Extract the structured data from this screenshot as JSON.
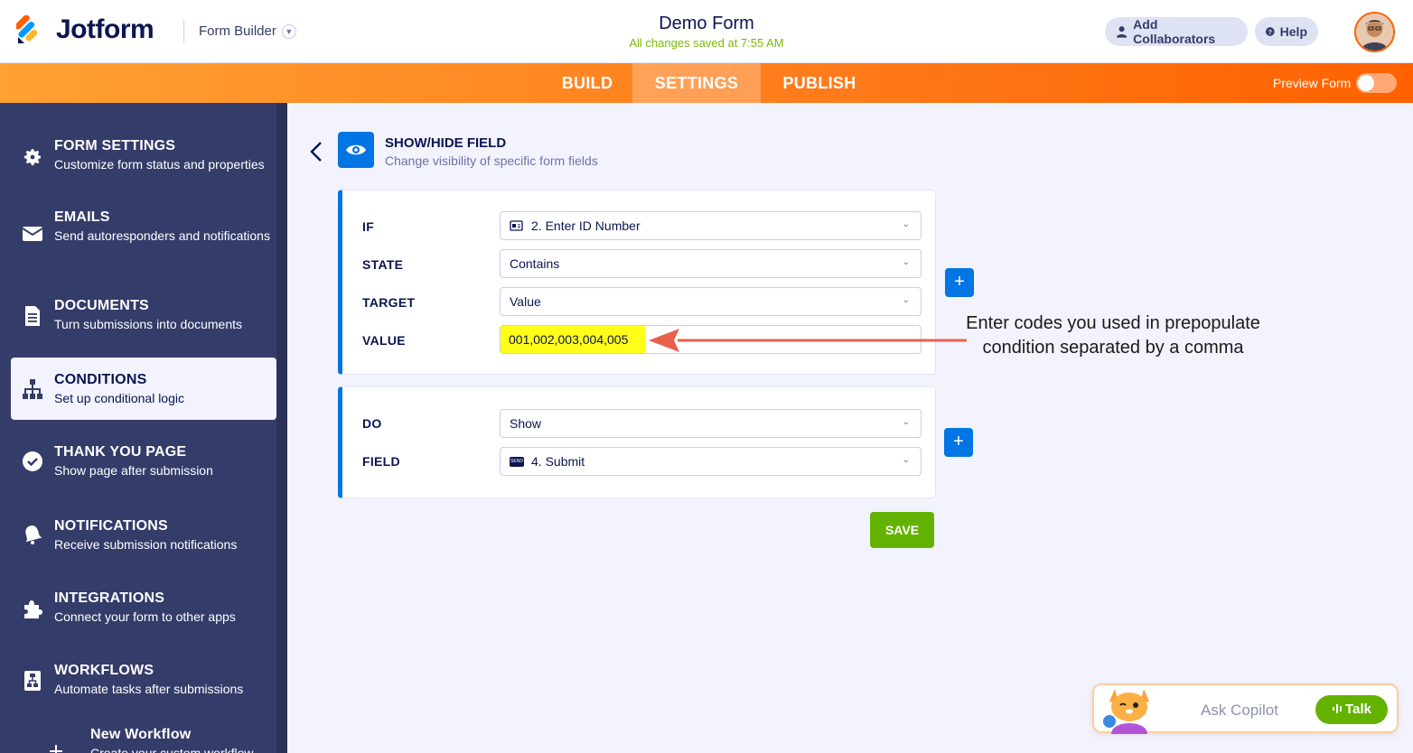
{
  "header": {
    "brand": "Jotform",
    "builder_label": "Form Builder",
    "form_title": "Demo Form",
    "saved_status": "All changes saved at 7:55 AM",
    "add_collaborators": "Add Collaborators",
    "help": "Help"
  },
  "nav": {
    "tabs": [
      "BUILD",
      "SETTINGS",
      "PUBLISH"
    ],
    "active_tab": "SETTINGS",
    "preview_label": "Preview Form",
    "preview_on": false
  },
  "sidebar": {
    "items": [
      {
        "title": "FORM SETTINGS",
        "subtitle": "Customize form status and properties",
        "icon": "gear-icon"
      },
      {
        "title": "EMAILS",
        "subtitle": "Send autoresponders and notifications",
        "icon": "envelope-icon"
      },
      {
        "title": "DOCUMENTS",
        "subtitle": "Turn submissions into documents",
        "icon": "document-icon"
      },
      {
        "title": "CONDITIONS",
        "subtitle": "Set up conditional logic",
        "icon": "hierarchy-icon"
      },
      {
        "title": "THANK YOU PAGE",
        "subtitle": "Show page after submission",
        "icon": "check-circle-icon"
      },
      {
        "title": "NOTIFICATIONS",
        "subtitle": "Receive submission notifications",
        "icon": "bell-icon"
      },
      {
        "title": "INTEGRATIONS",
        "subtitle": "Connect your form to other apps",
        "icon": "puzzle-icon"
      },
      {
        "title": "WORKFLOWS",
        "subtitle": "Automate tasks after submissions",
        "icon": "workflow-icon"
      },
      {
        "title": "New Workflow",
        "subtitle": "Create your custom workflow",
        "icon": "plus-icon"
      }
    ],
    "active_item": "CONDITIONS"
  },
  "condition": {
    "title": "SHOW/HIDE FIELD",
    "subtitle": "Change visibility of specific form fields",
    "if_label": "IF",
    "if_value": "2. Enter ID Number",
    "state_label": "STATE",
    "state_value": "Contains",
    "target_label": "TARGET",
    "target_value": "Value",
    "value_label": "VALUE",
    "value_value": "001,002,003,004,005",
    "do_label": "DO",
    "do_value": "Show",
    "field_label": "FIELD",
    "field_value": "4. Submit",
    "submit_badge": "SEND",
    "add_symbol": "+",
    "save_label": "SAVE"
  },
  "annotation": {
    "line1": "Enter codes you used in prepopulate",
    "line2": "condition separated by a comma",
    "color": "#e8604c"
  },
  "copilot": {
    "placeholder": "Ask Copilot",
    "talk_label": "Talk"
  },
  "colors": {
    "brand_orange": "#ff6100",
    "accent_blue": "#0075e3",
    "success_green": "#64b200",
    "sidebar": "#343c6a",
    "highlight": "#ffff19"
  }
}
